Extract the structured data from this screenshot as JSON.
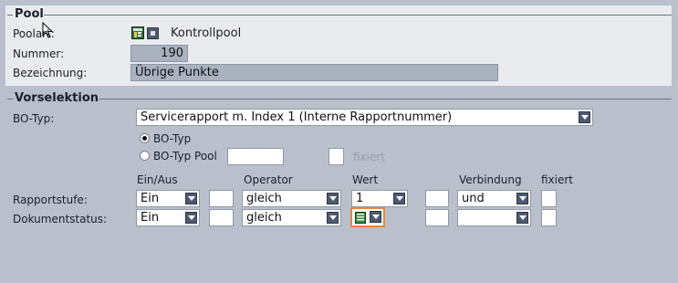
{
  "pool": {
    "title": "Pool",
    "poolart_label": "Poolart:",
    "poolart_value": "Kontrollpool",
    "nummer_label": "Nummer:",
    "nummer_value": "190",
    "bezeichnung_label": "Bezeichnung:",
    "bezeichnung_value": "Übrige Punkte"
  },
  "vorselektion": {
    "title": "Vorselektion",
    "bo_typ_label": "BO-Typ:",
    "bo_typ_value": "Servicerapport m. Index 1 (Interne Rapportnummer)",
    "radio_bo_typ": "BO-Typ",
    "radio_bo_typ_pool": "BO-Typ Pool",
    "fixiert_label": "fixiert",
    "columns": {
      "ein_aus": "Ein/Aus",
      "operator": "Operator",
      "wert": "Wert",
      "verbindung": "Verbindung",
      "fixiert": "fixiert"
    },
    "rows": [
      {
        "label": "Rapportstufe:",
        "ein_aus": "Ein",
        "operator": "gleich",
        "wert": "1",
        "verbindung": "und"
      },
      {
        "label": "Dokumentstatus:",
        "ein_aus": "Ein",
        "operator": "gleich",
        "wert": "",
        "verbindung": ""
      }
    ]
  },
  "colors": {
    "background": "#b9c0cc",
    "panel": "#e9ebef",
    "focus": "#e08a3c"
  }
}
